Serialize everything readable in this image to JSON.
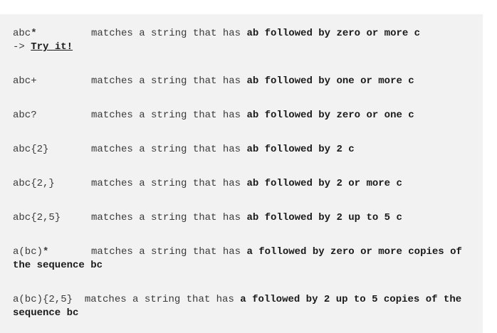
{
  "entries": [
    {
      "pattern": "abc",
      "pattern_suffix": "*",
      "prefix": "matches a string that has ",
      "bold": "ab followed by zero or more c",
      "arrow": "->",
      "link": "Try it!"
    },
    {
      "pattern": "abc+",
      "prefix": "matches a string that has ",
      "bold": "ab followed by one or more c"
    },
    {
      "pattern": "abc?",
      "prefix": "matches a string that has ",
      "bold": "ab followed by zero or one c"
    },
    {
      "pattern": "abc{2}",
      "prefix": "matches a string that has ",
      "bold": "ab followed by 2 c"
    },
    {
      "pattern": "abc{2,}",
      "prefix": "matches a string that has ",
      "bold": "ab followed by 2 or more c"
    },
    {
      "pattern": "abc{2,5}",
      "prefix": "matches a string that has ",
      "bold": "ab followed by 2 up to 5 c"
    },
    {
      "pattern": "a(bc)",
      "pattern_suffix": "*",
      "prefix": "matches a string that has ",
      "bold": "a followed by zero or more copies of the sequence bc"
    },
    {
      "pattern": "a(bc){2,5}",
      "prefix": "matches a string that has ",
      "bold": "a followed by 2 up to 5 copies of the sequence bc"
    }
  ]
}
